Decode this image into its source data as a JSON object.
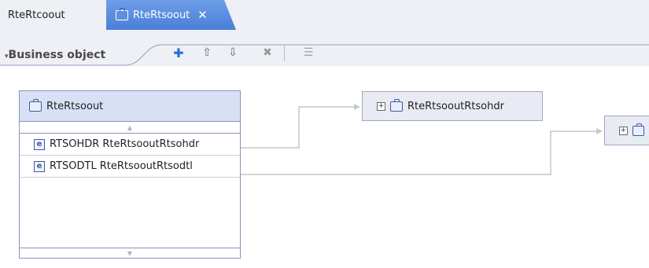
{
  "tabs": [
    {
      "label": "RteRtcoout",
      "active": false
    },
    {
      "label": "RteRtsoout",
      "active": true,
      "close_symbol": "✕"
    }
  ],
  "header": {
    "section_label": "Business object",
    "toolbar": [
      {
        "icon": "add-attribute-icon",
        "symbol": "✚"
      },
      {
        "icon": "move-up-icon",
        "symbol": "⇧"
      },
      {
        "icon": "move-down-icon",
        "symbol": "⇩"
      },
      {
        "icon": "delete-icon",
        "symbol": "✖"
      },
      {
        "icon": "properties-icon",
        "symbol": "☰"
      }
    ]
  },
  "business_object": {
    "name": "RteRtsoout",
    "attributes": [
      {
        "name": "RTSOHDR",
        "type": "RteRtsooutRtsohdr"
      },
      {
        "name": "RTSODTL",
        "type": "RteRtsooutRtsodtl"
      }
    ]
  },
  "children": [
    {
      "name": "RteRtsooutRtsohdr"
    },
    {
      "name": ""
    }
  ],
  "colors": {
    "accent": "#4a7fd8",
    "title_bg": "#d8e0f6",
    "border": "#8a94b8"
  }
}
